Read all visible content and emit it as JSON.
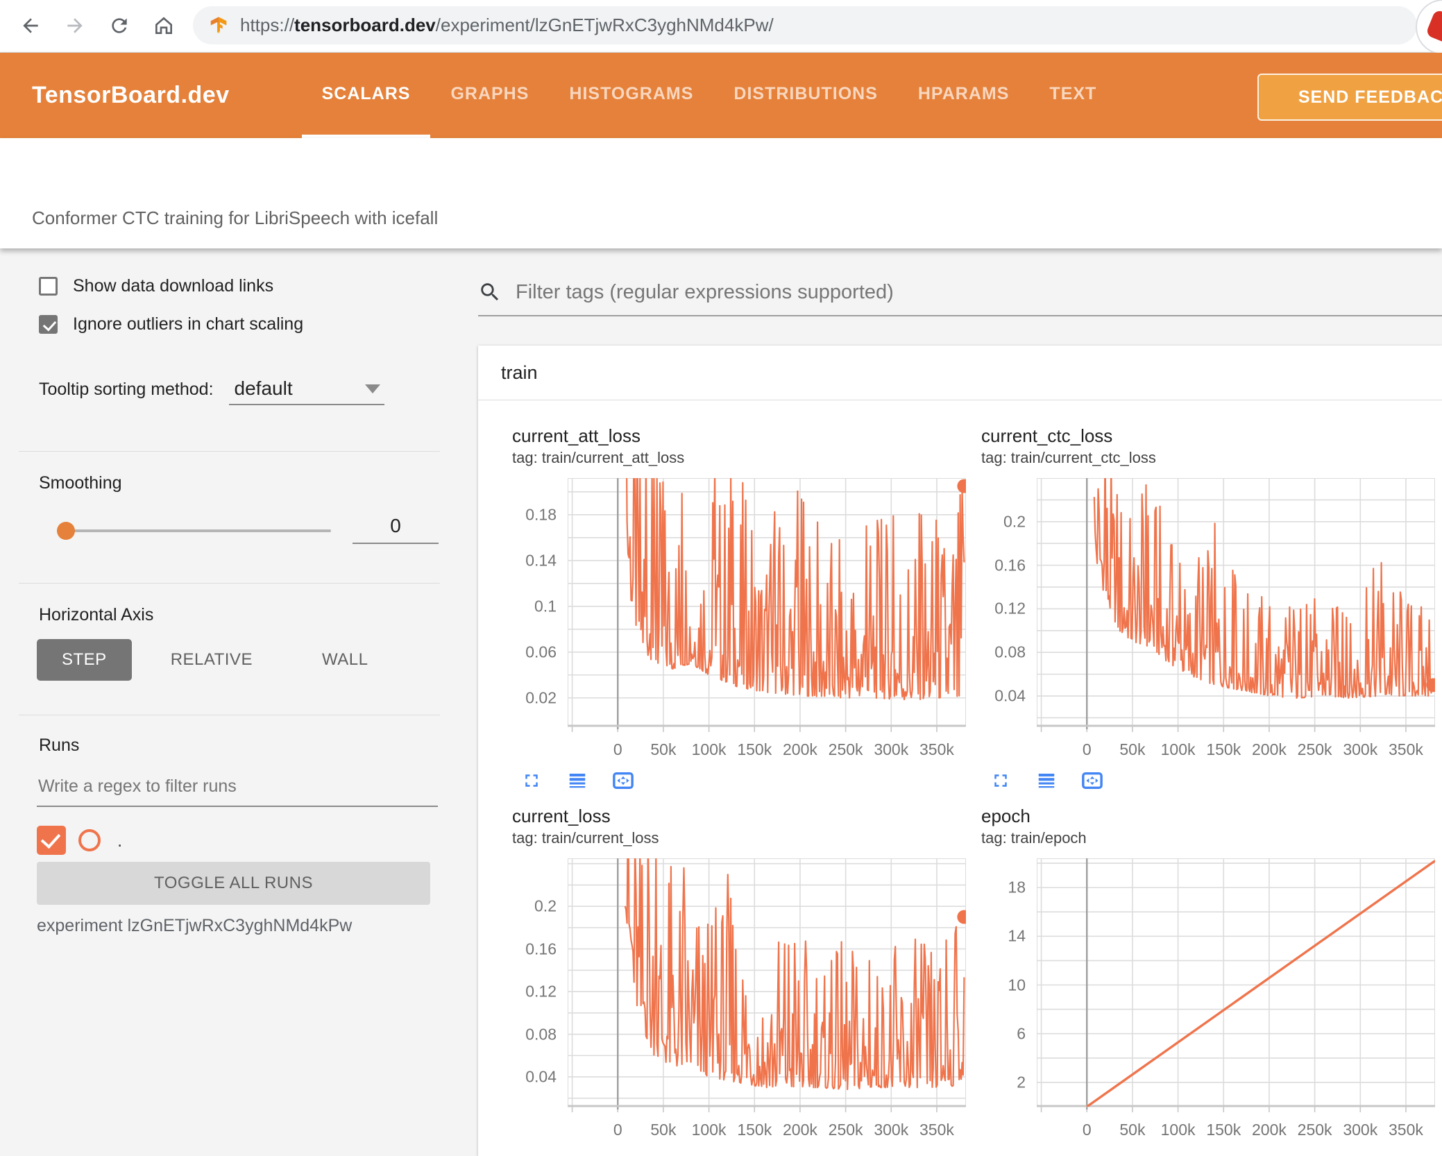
{
  "browser": {
    "url_scheme": "https://",
    "url_domain": "tensorboard.dev",
    "url_path": "/experiment/lzGnETjwRxC3yghNMd4kPw/"
  },
  "header": {
    "brand": "TensorBoard.dev",
    "tabs": [
      {
        "label": "SCALARS",
        "active": true
      },
      {
        "label": "GRAPHS",
        "active": false
      },
      {
        "label": "HISTOGRAMS",
        "active": false
      },
      {
        "label": "DISTRIBUTIONS",
        "active": false
      },
      {
        "label": "HPARAMS",
        "active": false
      },
      {
        "label": "TEXT",
        "active": false
      }
    ],
    "feedback_label": "SEND FEEDBACK"
  },
  "subtitle": "Conformer CTC training for LibriSpeech with icefall",
  "sidebar": {
    "show_links_label": "Show data download links",
    "ignore_outliers_label": "Ignore outliers in chart scaling",
    "tooltip_label": "Tooltip sorting method:",
    "tooltip_value": "default",
    "smoothing_label": "Smoothing",
    "smoothing_value": "0",
    "axis_label": "Horizontal Axis",
    "axis_options": [
      "STEP",
      "RELATIVE",
      "WALL"
    ],
    "runs_label": "Runs",
    "runs_placeholder": "Write a regex to filter runs",
    "run_name": ".",
    "toggle_all_label": "TOGGLE ALL RUNS",
    "experiment_caption": "experiment lzGnETjwRxC3yghNMd4kPw"
  },
  "main": {
    "filter_placeholder": "Filter tags (regular expressions supported)",
    "group_label": "train"
  },
  "colors": {
    "header_orange": "#e5813a",
    "feedback_orange": "#f0a142",
    "run_color": "#ef744c",
    "icon_blue": "#4285f4",
    "grid": "#dcdcdc",
    "zero_axis": "#9e9e9e",
    "bottom_axis": "#c7c7c7",
    "tick_text": "#757575"
  },
  "chart_data": [
    {
      "type": "line",
      "name": "current_att_loss",
      "tag_line": "tag: train/current_att_loss",
      "color": "#ef744c",
      "x_domain": [
        -55000,
        382000
      ],
      "y_domain": [
        -0.005,
        0.212
      ],
      "x_ticks": {
        "values": [
          0,
          50000,
          100000,
          150000,
          200000,
          250000,
          300000,
          350000
        ],
        "labels": [
          "0",
          "50k",
          "100k",
          "150k",
          "200k",
          "250k",
          "300k",
          "350k"
        ]
      },
      "y_ticks": {
        "values": [
          0.02,
          0.06,
          0.1,
          0.14,
          0.18
        ],
        "labels": [
          "0.02",
          "0.06",
          "0.1",
          "0.14",
          "0.18"
        ]
      },
      "grid_x": [
        -50000,
        0,
        50000,
        100000,
        150000,
        200000,
        250000,
        300000,
        350000
      ],
      "grid_y": [
        0.02,
        0.04,
        0.06,
        0.08,
        0.1,
        0.12,
        0.14,
        0.16,
        0.18,
        0.2
      ],
      "envelope": [
        [
          8000,
          0.17,
          0.3
        ],
        [
          15000,
          0.1,
          0.3
        ],
        [
          25000,
          0.065,
          0.25
        ],
        [
          40000,
          0.05,
          0.22
        ],
        [
          60000,
          0.045,
          0.21
        ],
        [
          80000,
          0.05,
          0.2
        ],
        [
          100000,
          0.04,
          0.23
        ],
        [
          130000,
          0.03,
          0.22
        ],
        [
          160000,
          0.025,
          0.18
        ],
        [
          200000,
          0.022,
          0.21
        ],
        [
          240000,
          0.02,
          0.16
        ],
        [
          280000,
          0.02,
          0.18
        ],
        [
          320000,
          0.018,
          0.19
        ],
        [
          355000,
          0.02,
          0.18
        ],
        [
          375000,
          0.015,
          0.21
        ],
        [
          380000,
          0.1,
          0.205
        ]
      ],
      "end_dot": [
        380000,
        0.205
      ]
    },
    {
      "type": "line",
      "name": "current_ctc_loss",
      "tag_line": "tag: train/current_ctc_loss",
      "color": "#ef744c",
      "x_domain": [
        -55000,
        382000
      ],
      "y_domain": [
        0.012,
        0.24
      ],
      "x_ticks": {
        "values": [
          0,
          50000,
          100000,
          150000,
          200000,
          250000,
          300000,
          350000
        ],
        "labels": [
          "0",
          "50k",
          "100k",
          "150k",
          "200k",
          "250k",
          "300k",
          "350k"
        ]
      },
      "y_ticks": {
        "values": [
          0.04,
          0.08,
          0.12,
          0.16,
          0.2
        ],
        "labels": [
          "0.04",
          "0.08",
          "0.12",
          "0.16",
          "0.2"
        ]
      },
      "grid_x": [
        -50000,
        0,
        50000,
        100000,
        150000,
        200000,
        250000,
        300000,
        350000
      ],
      "grid_y": [
        0.02,
        0.04,
        0.06,
        0.08,
        0.1,
        0.12,
        0.14,
        0.16,
        0.18,
        0.2,
        0.22,
        0.24
      ],
      "envelope": [
        [
          8000,
          0.17,
          0.3
        ],
        [
          20000,
          0.13,
          0.27
        ],
        [
          35000,
          0.1,
          0.25
        ],
        [
          50000,
          0.09,
          0.21
        ],
        [
          70000,
          0.085,
          0.25
        ],
        [
          90000,
          0.07,
          0.19
        ],
        [
          110000,
          0.06,
          0.15
        ],
        [
          140000,
          0.05,
          0.2
        ],
        [
          170000,
          0.045,
          0.14
        ],
        [
          200000,
          0.04,
          0.14
        ],
        [
          230000,
          0.038,
          0.12
        ],
        [
          260000,
          0.04,
          0.14
        ],
        [
          290000,
          0.038,
          0.11
        ],
        [
          320000,
          0.04,
          0.17
        ],
        [
          350000,
          0.04,
          0.145
        ],
        [
          375000,
          0.04,
          0.12
        ],
        [
          380000,
          0.045,
          0.06
        ]
      ],
      "end_dot": [
        380000,
        0.05
      ]
    },
    {
      "type": "line",
      "name": "current_loss",
      "tag_line": "tag: train/current_loss",
      "color": "#ef744c",
      "x_domain": [
        -55000,
        382000
      ],
      "y_domain": [
        0.012,
        0.245
      ],
      "x_ticks": {
        "values": [
          0,
          50000,
          100000,
          150000,
          200000,
          250000,
          300000,
          350000
        ],
        "labels": [
          "0",
          "50k",
          "100k",
          "150k",
          "200k",
          "250k",
          "300k",
          "350k"
        ]
      },
      "y_ticks": {
        "values": [
          0.04,
          0.08,
          0.12,
          0.16,
          0.2
        ],
        "labels": [
          "0.04",
          "0.08",
          "0.12",
          "0.16",
          "0.2"
        ]
      },
      "grid_x": [
        -50000,
        0,
        50000,
        100000,
        150000,
        200000,
        250000,
        300000,
        350000
      ],
      "grid_y": [
        0.02,
        0.04,
        0.06,
        0.08,
        0.1,
        0.12,
        0.14,
        0.16,
        0.18,
        0.2,
        0.22,
        0.24
      ],
      "envelope": [
        [
          8000,
          0.2,
          0.35
        ],
        [
          15000,
          0.13,
          0.32
        ],
        [
          25000,
          0.09,
          0.28
        ],
        [
          40000,
          0.06,
          0.26
        ],
        [
          60000,
          0.05,
          0.25
        ],
        [
          80000,
          0.05,
          0.24
        ],
        [
          100000,
          0.04,
          0.19
        ],
        [
          130000,
          0.035,
          0.25
        ],
        [
          160000,
          0.03,
          0.16
        ],
        [
          190000,
          0.03,
          0.23
        ],
        [
          220000,
          0.03,
          0.13
        ],
        [
          250000,
          0.028,
          0.18
        ],
        [
          280000,
          0.03,
          0.15
        ],
        [
          310000,
          0.03,
          0.17
        ],
        [
          340000,
          0.03,
          0.17
        ],
        [
          365000,
          0.03,
          0.175
        ],
        [
          380000,
          0.04,
          0.19
        ]
      ],
      "end_dot": [
        380000,
        0.19
      ]
    },
    {
      "type": "line",
      "name": "epoch",
      "tag_line": "tag: train/epoch",
      "color": "#ef744c",
      "x_domain": [
        -55000,
        382000
      ],
      "y_domain": [
        0,
        20.4
      ],
      "x_ticks": {
        "values": [
          0,
          50000,
          100000,
          150000,
          200000,
          250000,
          300000,
          350000
        ],
        "labels": [
          "0",
          "50k",
          "100k",
          "150k",
          "200k",
          "250k",
          "300k",
          "350k"
        ]
      },
      "y_ticks": {
        "values": [
          2,
          6,
          10,
          14,
          18
        ],
        "labels": [
          "2",
          "6",
          "10",
          "14",
          "18"
        ]
      },
      "grid_x": [
        -50000,
        0,
        50000,
        100000,
        150000,
        200000,
        250000,
        300000,
        350000
      ],
      "grid_y": [
        2,
        4,
        6,
        8,
        10,
        12,
        14,
        16,
        18,
        20
      ],
      "points": [
        [
          0,
          0
        ],
        [
          382000,
          20.2
        ]
      ]
    }
  ]
}
